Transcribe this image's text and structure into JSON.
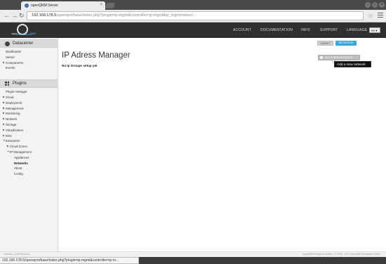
{
  "browser": {
    "tab_title": "openQRM Server",
    "url_host": "192.168.178.5",
    "url_path": "/openqrm/base/index.php?plugin=ip-mgmt&controller=ip-mgmt&ip_mgmt=select",
    "status_url": "192.168.178.5/openqrm/base/index.php?plugin=ip-mgmt&controller=ip-m..."
  },
  "header": {
    "logo_left": "open",
    "logo_right": "QRM",
    "nav": [
      "ACCOUNT",
      "DOCUMENTATION",
      "INFO",
      "SUPPORT"
    ],
    "language_label": "LANGUAGE",
    "language_value": "en"
  },
  "sidebar": {
    "datacenter_title": "Datacenter",
    "datacenter_items": [
      {
        "label": "Dashboard",
        "arrow": false
      },
      {
        "label": "Server",
        "arrow": false
      },
      {
        "label": "Components",
        "arrow": true
      },
      {
        "label": "Events",
        "arrow": false
      }
    ],
    "plugins_title": "Plugins",
    "plugin_items": [
      {
        "label": "Plugin manager",
        "arrow": false,
        "indent": 0
      },
      {
        "label": "Cloud",
        "arrow": true,
        "indent": 0
      },
      {
        "label": "Deployment",
        "arrow": true,
        "indent": 0
      },
      {
        "label": "Management",
        "arrow": true,
        "indent": 0
      },
      {
        "label": "Monitoring",
        "arrow": true,
        "indent": 0
      },
      {
        "label": "Network",
        "arrow": true,
        "indent": 0
      },
      {
        "label": "Storage",
        "arrow": true,
        "indent": 0
      },
      {
        "label": "Virtualization",
        "arrow": true,
        "indent": 0
      },
      {
        "label": "Misc",
        "arrow": true,
        "indent": 0
      },
      {
        "label": "Enterprise",
        "arrow": true,
        "open": true,
        "indent": 0
      },
      {
        "label": "Cloud Zones",
        "arrow": true,
        "indent": 1
      },
      {
        "label": "IP Management",
        "arrow": true,
        "open": true,
        "indent": 1
      },
      {
        "label": "Appliances",
        "arrow": false,
        "indent": 2
      },
      {
        "label": "Networks",
        "arrow": false,
        "indent": 2,
        "active": true
      },
      {
        "label": "About",
        "arrow": false,
        "indent": 2
      },
      {
        "label": "Config",
        "arrow": false,
        "indent": 2
      }
    ]
  },
  "main": {
    "tab_inactive": "SUBNET",
    "tab_active": "NETWORKS",
    "title": "IP Adress Manager",
    "message": "No Ip Groups setup yet",
    "add_button": "ADD A NEW NETWORK",
    "tooltip": "Add a new network"
  },
  "footer": {
    "left": "Memory: 4.45 MB Used",
    "right": "openQRM Enterprise Edition | © 2006 - 2013 openQRM Enterprise GmbH"
  },
  "colors": {
    "header_bg": "#2f3030",
    "accent_blue": "#3aa5d6",
    "sidebar_bg": "#f3f3f3"
  }
}
